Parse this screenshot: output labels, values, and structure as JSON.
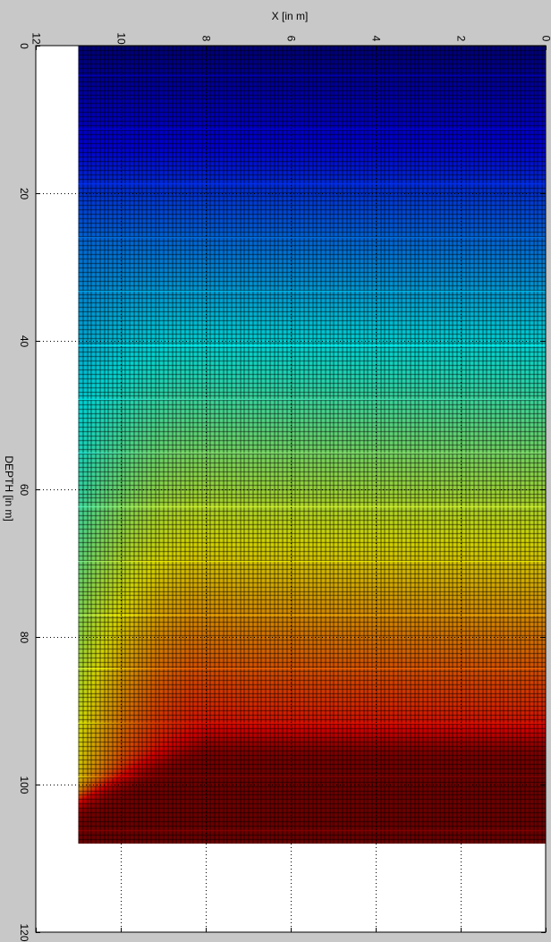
{
  "chart_data": {
    "type": "heatmap",
    "title": "",
    "xlabel": "X [in m]",
    "ylabel": "DEPTH [in m]",
    "x_axis_position": "top",
    "x_reversed": true,
    "y_reversed": true,
    "xlim": [
      0,
      12
    ],
    "ylim": [
      0,
      120
    ],
    "x_ticks": [
      0,
      2,
      4,
      6,
      8,
      10,
      12
    ],
    "y_ticks": [
      0,
      20,
      40,
      60,
      80,
      100,
      120
    ],
    "x_tick_labels": [
      "0",
      "2",
      "4",
      "6",
      "8",
      "10",
      "12"
    ],
    "y_tick_labels": [
      "0",
      "20",
      "40",
      "60",
      "80",
      "100",
      "120"
    ],
    "tick_label_rotation_deg": 90,
    "grid": true,
    "grid_style": "dotted",
    "colormap": "jet",
    "colormap_stops": [
      "#00008f",
      "#0000ff",
      "#00ffff",
      "#ffff00",
      "#ff0000",
      "#800000"
    ],
    "data_extent": {
      "x": [
        0,
        11
      ],
      "depth": [
        0,
        108
      ]
    },
    "mesh": {
      "columns": 110,
      "rows": 180
    },
    "field_description_points": [
      {
        "x": 0,
        "depth": 0,
        "value": 0.0
      },
      {
        "x": 0,
        "depth": 20,
        "value": 0.15
      },
      {
        "x": 0,
        "depth": 40,
        "value": 0.33
      },
      {
        "x": 0,
        "depth": 60,
        "value": 0.52
      },
      {
        "x": 0,
        "depth": 80,
        "value": 0.72
      },
      {
        "x": 0,
        "depth": 100,
        "value": 0.92
      },
      {
        "x": 0,
        "depth": 108,
        "value": 1.0
      },
      {
        "x": 11,
        "depth": 60,
        "value": 0.42
      },
      {
        "x": 11,
        "depth": 80,
        "value": 0.5
      },
      {
        "x": 11,
        "depth": 100,
        "value": 0.58
      },
      {
        "x": 11,
        "depth": 104,
        "value": 0.95
      }
    ]
  }
}
